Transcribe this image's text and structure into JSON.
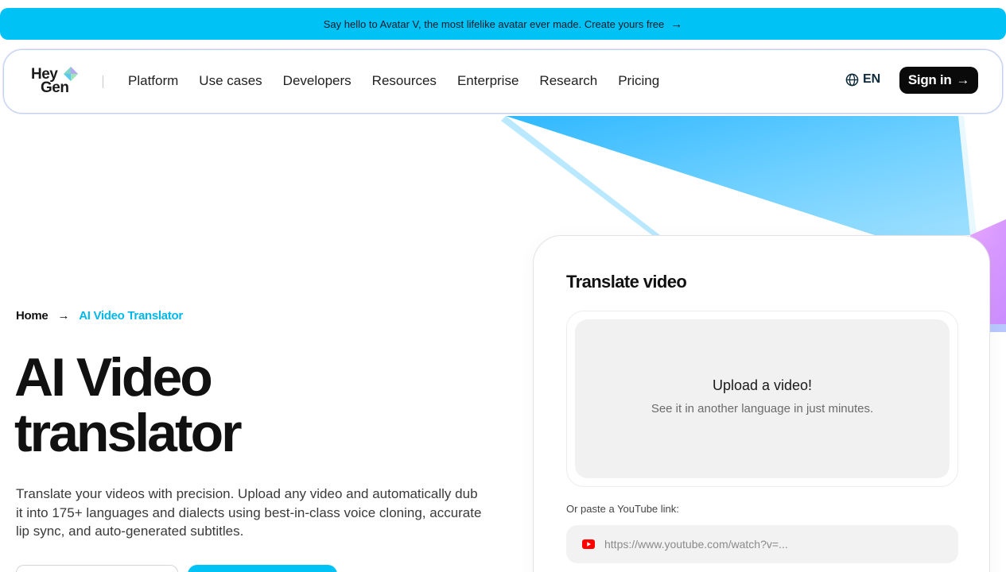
{
  "banner": {
    "text": "Say hello to Avatar V, the most lifelike avatar ever made. Create yours free",
    "arrow_icon": "arrow-right-icon"
  },
  "nav": {
    "logo_line1": "Hey",
    "logo_line2": "Gen",
    "links": [
      "Platform",
      "Use cases",
      "Developers",
      "Resources",
      "Enterprise",
      "Research",
      "Pricing"
    ],
    "language": "EN",
    "signin_label": "Sign in"
  },
  "breadcrumb": {
    "home": "Home",
    "current": "AI Video Translator"
  },
  "hero": {
    "title_line1": "AI Video",
    "title_line2": "translator",
    "description": "Translate your videos with precision. Upload any video and automatically dub it into 175+ languages and dialects using best-in-class voice cloning, accurate lip sync, and auto-generated subtitles."
  },
  "card": {
    "title": "Translate video",
    "upload_title": "Upload a video!",
    "upload_subtitle": "See it in another language in just minutes.",
    "paste_label": "Or paste a YouTube link:",
    "youtube_placeholder": "https://www.youtube.com/watch?v=..."
  },
  "colors": {
    "accent": "#00c2f5",
    "dark": "#0a0a0a",
    "youtube_red": "#ff0000"
  }
}
